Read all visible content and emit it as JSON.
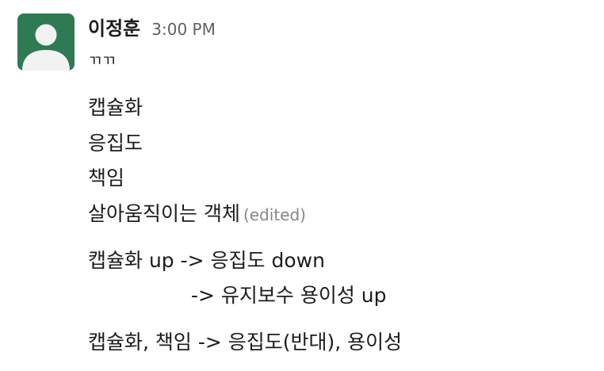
{
  "message": {
    "sender": "이정훈",
    "time": "3:00 PM",
    "lines": [
      "ㄲㄲ",
      "캡슐화",
      "응집도",
      "책임",
      "살아움직이는 객체",
      "캡슐화 up -> 응집도 down",
      "-> 유지보수 용이성 up",
      "캡슐화, 책임 -> 응집도(반대), 용이성"
    ],
    "edited_label": "(edited)"
  },
  "colors": {
    "avatar_bg": "#2f7a55",
    "avatar_figure": "#f2f2f2",
    "text": "#1d1c1d",
    "timestamp": "#616061",
    "edited": "#868686"
  },
  "icons": {
    "avatar": "default-user-avatar-icon"
  }
}
